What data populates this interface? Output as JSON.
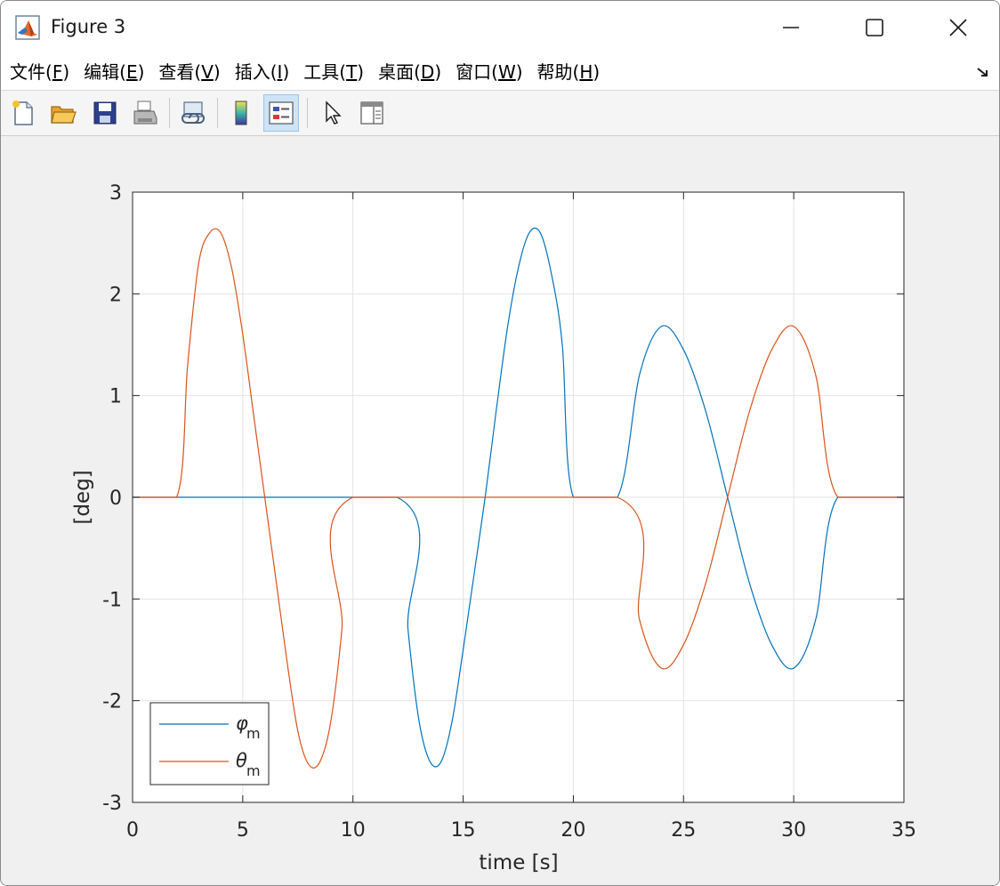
{
  "window": {
    "title": "Figure 3",
    "controls": {
      "minimize": "minimize",
      "maximize": "maximize",
      "close": "close"
    }
  },
  "menu": [
    {
      "label": "文件(",
      "key": "F",
      "suffix": ")"
    },
    {
      "label": "编辑(",
      "key": "E",
      "suffix": ")"
    },
    {
      "label": "查看(",
      "key": "V",
      "suffix": ")"
    },
    {
      "label": "插入(",
      "key": "I",
      "suffix": ")"
    },
    {
      "label": "工具(",
      "key": "T",
      "suffix": ")"
    },
    {
      "label": "桌面(",
      "key": "D",
      "suffix": ")"
    },
    {
      "label": "窗口(",
      "key": "W",
      "suffix": ")"
    },
    {
      "label": "帮助(",
      "key": "H",
      "suffix": ")"
    }
  ],
  "toolbar": [
    {
      "name": "new-figure-button",
      "icon": "new-file-icon"
    },
    {
      "name": "open-file-button",
      "icon": "folder-open-icon"
    },
    {
      "name": "save-button",
      "icon": "save-icon"
    },
    {
      "name": "print-button",
      "icon": "printer-icon"
    },
    {
      "name": "link-plot-button",
      "icon": "link-plot-icon"
    },
    {
      "name": "colorbar-button",
      "icon": "colorbar-icon"
    },
    {
      "name": "legend-button",
      "icon": "legend-icon",
      "active": true
    },
    {
      "name": "select-arrow-button",
      "icon": "cursor-arrow-icon"
    },
    {
      "name": "property-inspector-button",
      "icon": "panel-icon"
    }
  ],
  "colors": {
    "series_phi": "#0072BD",
    "series_theta": "#D95319",
    "grid": "#e3e3e3",
    "axes": "#262626"
  },
  "chart_data": {
    "type": "line",
    "xlabel": "time [s]",
    "ylabel": "[deg]",
    "xlim": [
      0,
      35
    ],
    "ylim": [
      -3,
      3
    ],
    "xticks": [
      0,
      5,
      10,
      15,
      20,
      25,
      30,
      35
    ],
    "yticks": [
      -3,
      -2,
      -1,
      0,
      1,
      2,
      3
    ],
    "grid": true,
    "legend_position": "bottom-left",
    "series": [
      {
        "name": "φ",
        "subscript": "m",
        "color": "#0072BD",
        "x": [
          0,
          12,
          12.5,
          13,
          13.5,
          14,
          14.5,
          15,
          15.5,
          16,
          16.5,
          17,
          17.5,
          18,
          18.5,
          19,
          19.5,
          20,
          22,
          23,
          24,
          25,
          26,
          27,
          28,
          29,
          30,
          31,
          32,
          35
        ],
        "y": [
          0,
          0,
          -1.3,
          -2.2,
          -2.6,
          -2.6,
          -2.2,
          -1.5,
          -0.75,
          0,
          0.85,
          1.65,
          2.25,
          2.6,
          2.6,
          2.2,
          1.5,
          0,
          0,
          1.2,
          1.68,
          1.45,
          0.85,
          0,
          -0.85,
          -1.45,
          -1.68,
          -1.2,
          0,
          0
        ]
      },
      {
        "name": "θ",
        "subscript": "m",
        "color": "#D95319",
        "x": [
          0,
          2,
          2.5,
          3,
          3.5,
          4,
          4.5,
          5,
          5.5,
          6,
          6.5,
          7,
          7.5,
          8,
          8.5,
          9,
          9.5,
          10,
          22,
          23,
          24,
          25,
          26,
          27,
          28,
          29,
          30,
          31,
          32,
          35
        ],
        "y": [
          0,
          0,
          1.3,
          2.3,
          2.6,
          2.6,
          2.25,
          1.6,
          0.8,
          0,
          -0.8,
          -1.6,
          -2.3,
          -2.63,
          -2.6,
          -2.2,
          -1.3,
          0,
          0,
          -1.2,
          -1.68,
          -1.45,
          -0.85,
          0,
          0.85,
          1.45,
          1.68,
          1.2,
          0,
          0
        ]
      }
    ]
  }
}
